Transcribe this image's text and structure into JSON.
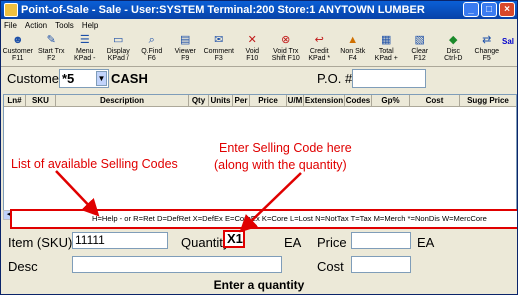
{
  "window": {
    "title": "Point-of-Sale - Sale - User:SYSTEM Terminal:200 Store:1 ANYTOWN LUMBER",
    "minimize": "_",
    "maximize": "□",
    "close": "×"
  },
  "menu": [
    "File",
    "Action",
    "Tools",
    "Help"
  ],
  "toolbar": [
    {
      "l1": "Customer",
      "l2": "F11",
      "icon": "customer-icon"
    },
    {
      "l1": "Start Trx",
      "l2": "F2",
      "icon": "start-trx-icon"
    },
    {
      "l1": "Menu",
      "l2": "KPad -",
      "icon": "menu-icon"
    },
    {
      "l1": "Display",
      "l2": "KPad /",
      "icon": "display-icon"
    },
    {
      "l1": "Q.Find",
      "l2": "F6",
      "icon": "qfind-icon"
    },
    {
      "l1": "Viewer",
      "l2": "F9",
      "icon": "viewer-icon"
    },
    {
      "l1": "Comment",
      "l2": "F3",
      "icon": "comment-icon"
    },
    {
      "l1": "Void",
      "l2": "F10",
      "icon": "void-icon"
    },
    {
      "l1": "Void Trx",
      "l2": "Shift F10",
      "icon": "void-trx-icon"
    },
    {
      "l1": "Credit",
      "l2": "KPad *",
      "icon": "credit-icon"
    },
    {
      "l1": "Non Stk",
      "l2": "F4",
      "icon": "non-stock-icon"
    },
    {
      "l1": "Total",
      "l2": "KPad +",
      "icon": "total-icon"
    },
    {
      "l1": "Clear",
      "l2": "F12",
      "icon": "clear-icon"
    },
    {
      "l1": "Disc",
      "l2": "Ctrl-D",
      "icon": "discount-icon"
    },
    {
      "l1": "Change",
      "l2": "F5",
      "icon": "change-icon"
    }
  ],
  "sal_label": "Sal",
  "customer": {
    "label": "Customer",
    "value": "*5",
    "name": "CASH",
    "po_label": "P.O. #",
    "po_value": ""
  },
  "grid": {
    "columns": [
      "Ln#",
      "SKU",
      "Description",
      "Qty",
      "Units",
      "Per",
      "Price",
      "U/M",
      "Extension",
      "Codes",
      "Gp%",
      "Cost",
      "Sugg Price"
    ]
  },
  "codes_hint": "H=Help - or R=Ret D=DefRet X=DefEx E=CoreEx K=Core L=Lost N=NotTax T=Tax M=Merch *=NonDis W=MercCore",
  "annotations": {
    "list_codes": "List of available Selling Codes",
    "enter_code_1": "Enter Selling Code here",
    "enter_code_2": "(along with the quantity)"
  },
  "item": {
    "sku_label": "Item (SKU)",
    "sku_value": "11111",
    "qty_label": "Quantity",
    "qty_value": "X1",
    "qty_unit": "EA",
    "price_label": "Price",
    "price_value": "",
    "price_unit": "EA",
    "desc_label": "Desc",
    "desc_value": "",
    "cost_label": "Cost",
    "cost_value": ""
  },
  "status": "Enter a quantity"
}
